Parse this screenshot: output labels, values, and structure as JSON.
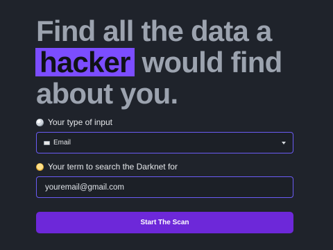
{
  "hero": {
    "line1": "Find all the data a",
    "highlight": "hacker",
    "line2_rest": " would find",
    "line3": "about you."
  },
  "input_type": {
    "label": "Your type of input",
    "label_icon": "globe-icon",
    "selected": "Email",
    "selected_icon": "envelope-icon"
  },
  "search_term": {
    "label": "Your term to search the Darknet for",
    "label_icon": "face-icon",
    "value": "youremail@gmail.com"
  },
  "actions": {
    "scan_label": "Start The Scan"
  },
  "colors": {
    "background": "#1f232b",
    "accent": "#6d28d9",
    "highlight": "#7c4dff",
    "border": "#6b5cf6"
  }
}
